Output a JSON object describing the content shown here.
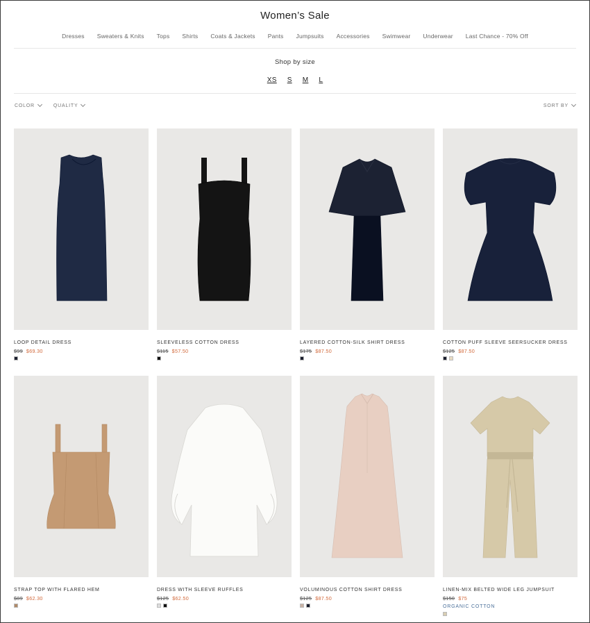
{
  "header": {
    "title": "Women’s Sale"
  },
  "nav": [
    "Dresses",
    "Sweaters & Knits",
    "Tops",
    "Shirts",
    "Coats & Jackets",
    "Pants",
    "Jumpsuits",
    "Accessories",
    "Swimwear",
    "Underwear",
    "Last Chance - 70% Off"
  ],
  "size_filter": {
    "title": "Shop by size",
    "sizes": [
      "XS",
      "S",
      "M",
      "L"
    ]
  },
  "filters": {
    "color": "COLOR",
    "quality": "QUALITY",
    "sort": "SORT BY"
  },
  "products": [
    {
      "name": "LOOP DETAIL DRESS",
      "old_price": "$99",
      "new_price": "$69.30",
      "tag": "",
      "swatches": [
        "#1b1f2e"
      ],
      "garment": "sleeveless-dress",
      "color": "#1f2a44"
    },
    {
      "name": "SLEEVELESS COTTON DRESS",
      "old_price": "$115",
      "new_price": "$57.50",
      "tag": "",
      "swatches": [
        "#111111"
      ],
      "garment": "strap-dress",
      "color": "#141414"
    },
    {
      "name": "LAYERED COTTON-SILK SHIRT DRESS",
      "old_price": "$175",
      "new_price": "$87.50",
      "tag": "",
      "swatches": [
        "#1b1f2e"
      ],
      "garment": "cape-dress",
      "color": "#1c2233"
    },
    {
      "name": "COTTON PUFF SLEEVE SEERSUCKER DRESS",
      "old_price": "$125",
      "new_price": "$87.50",
      "tag": "",
      "swatches": [
        "#1b1f2e",
        "#e9dcc4"
      ],
      "garment": "puff-dress",
      "color": "#18213a"
    },
    {
      "name": "STRAP TOP WITH FLARED HEM",
      "old_price": "$89",
      "new_price": "$62.30",
      "tag": "",
      "swatches": [
        "#b08a68"
      ],
      "garment": "strap-top",
      "color": "#c49a73"
    },
    {
      "name": "DRESS WITH SLEEVE RUFFLES",
      "old_price": "$125",
      "new_price": "$62.50",
      "tag": "",
      "swatches": [
        "#dddddd",
        "#111111"
      ],
      "garment": "ruffle-dress",
      "color": "#fbfbf9"
    },
    {
      "name": "VOLUMINOUS COTTON SHIRT DRESS",
      "old_price": "$125",
      "new_price": "$87.50",
      "tag": "",
      "swatches": [
        "#c9b2a4",
        "#1b1f2e"
      ],
      "garment": "shirt-dress",
      "color": "#e8cfc2"
    },
    {
      "name": "LINEN-MIX BELTED WIDE LEG JUMPSUIT",
      "old_price": "$150",
      "new_price": "$75",
      "tag": "ORGANIC COTTON",
      "swatches": [
        "#d8cdb2"
      ],
      "garment": "jumpsuit",
      "color": "#d6c9a8"
    }
  ]
}
